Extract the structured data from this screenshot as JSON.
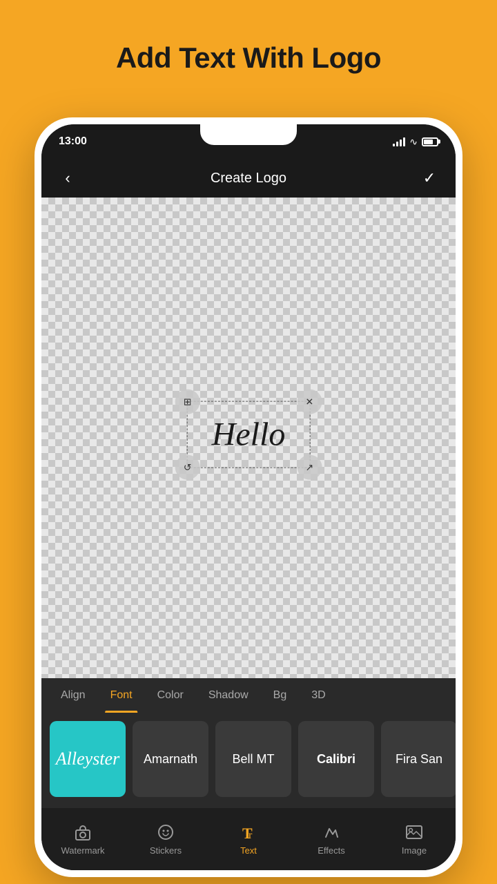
{
  "page": {
    "title": "Add Text With Logo",
    "bg_color": "#F5A623"
  },
  "status_bar": {
    "time": "13:00"
  },
  "nav_bar": {
    "title": "Create Logo",
    "back_icon": "‹",
    "check_icon": "✓"
  },
  "canvas": {
    "text": "Hello"
  },
  "handles": {
    "tl": "⊞",
    "tr": "✕",
    "bl": "↺",
    "br": "↗"
  },
  "font_tabs": {
    "items": [
      {
        "label": "Align",
        "active": false
      },
      {
        "label": "Font",
        "active": true
      },
      {
        "label": "Color",
        "active": false
      },
      {
        "label": "Shadow",
        "active": false
      },
      {
        "label": "Bg",
        "active": false
      },
      {
        "label": "3D",
        "active": false
      }
    ]
  },
  "font_list": {
    "fonts": [
      {
        "name": "Alleyster",
        "display": "Alleyster",
        "selected": true,
        "style": "script"
      },
      {
        "name": "Amarnath",
        "display": "Amarnath",
        "selected": false,
        "style": "normal"
      },
      {
        "name": "Bell MT",
        "display": "Bell MT",
        "selected": false,
        "style": "normal"
      },
      {
        "name": "Calibri",
        "display": "Calibri",
        "selected": false,
        "style": "bold"
      },
      {
        "name": "Fira Sans",
        "display": "Fira San",
        "selected": false,
        "style": "normal"
      }
    ]
  },
  "bottom_nav": {
    "items": [
      {
        "label": "Watermark",
        "icon": "watermark",
        "active": false
      },
      {
        "label": "Stickers",
        "icon": "stickers",
        "active": false
      },
      {
        "label": "Text",
        "icon": "text",
        "active": true
      },
      {
        "label": "Effects",
        "icon": "effects",
        "active": false
      },
      {
        "label": "Image",
        "icon": "image",
        "active": false
      }
    ]
  }
}
